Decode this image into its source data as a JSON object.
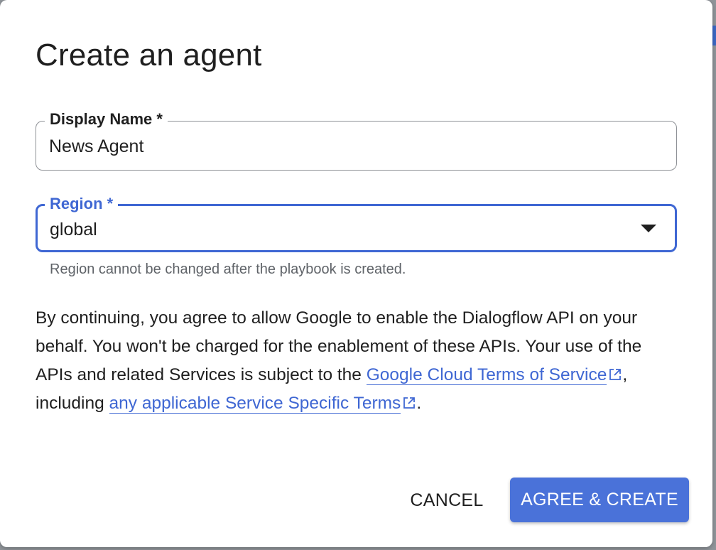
{
  "dialog": {
    "title": "Create an agent"
  },
  "display_name": {
    "label": "Display Name *",
    "value": "News Agent"
  },
  "region": {
    "label": "Region *",
    "value": "global",
    "hint": "Region cannot be changed after the playbook is created."
  },
  "notice": {
    "text_before": "By continuing, you agree to allow Google to enable the Dialogflow API on your behalf. You won't be charged for the enablement of these APIs. Your use of the APIs and related Services is subject to the ",
    "link_terms": "Google Cloud Terms of Service",
    "text_middle": ", including ",
    "link_specific": "any applicable Service Specific Terms",
    "text_after": "."
  },
  "actions": {
    "cancel_label": "CANCEL",
    "create_label": "AGREE & CREATE"
  },
  "colors": {
    "accent": "#3f67d3",
    "primary_button": "#4a72d9",
    "text": "#1f1f1f",
    "hint": "#5f6368"
  },
  "icons": {
    "dropdown": "arrow-drop-down-icon",
    "external_link": "open-in-new-icon"
  }
}
